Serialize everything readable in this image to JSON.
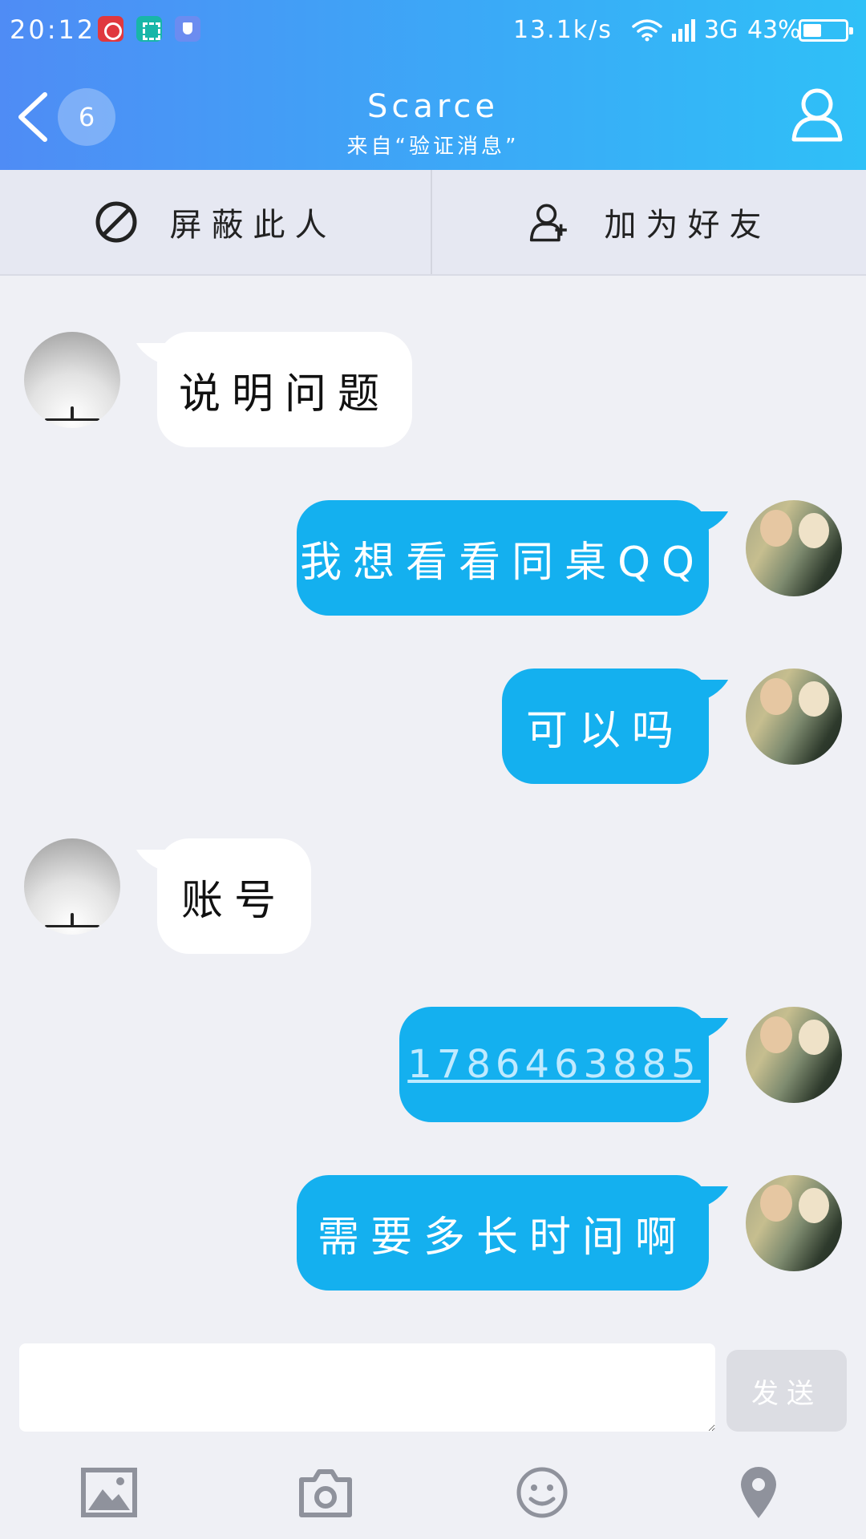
{
  "status_bar": {
    "time": "20:12",
    "speed": "13.1k/s",
    "network": "3G",
    "battery_percent": "43%",
    "battery_level": 0.43,
    "icons": [
      "netease-music-icon",
      "scan-icon",
      "shield-icon",
      "wifi-icon",
      "signal-icon",
      "battery-icon"
    ]
  },
  "titlebar": {
    "unread_count": "6",
    "title": "Scarce",
    "subtitle": "来自“验证消息”"
  },
  "actions": {
    "block_label": "屏蔽此人",
    "add_friend_label": "加为好友"
  },
  "messages": [
    {
      "sender": "other",
      "text": "说明问题"
    },
    {
      "sender": "me",
      "text": "我想看看同桌QQ"
    },
    {
      "sender": "me",
      "text": "可以吗"
    },
    {
      "sender": "other",
      "text": "账号"
    },
    {
      "sender": "me",
      "text": "1786463885",
      "is_link": true
    },
    {
      "sender": "me",
      "text": "需要多长时间啊"
    }
  ],
  "composer": {
    "input_value": "",
    "send_label": "发送"
  },
  "toolbar": {
    "icons": [
      "image-icon",
      "camera-icon",
      "emoji-icon",
      "location-icon"
    ]
  },
  "colors": {
    "header_start": "#4f8cf5",
    "header_end": "#2fc0f7",
    "outgoing_bubble": "#14b0ef",
    "incoming_bubble": "#ffffff",
    "background": "#eff0f5",
    "icon_gray": "#8f929c"
  }
}
